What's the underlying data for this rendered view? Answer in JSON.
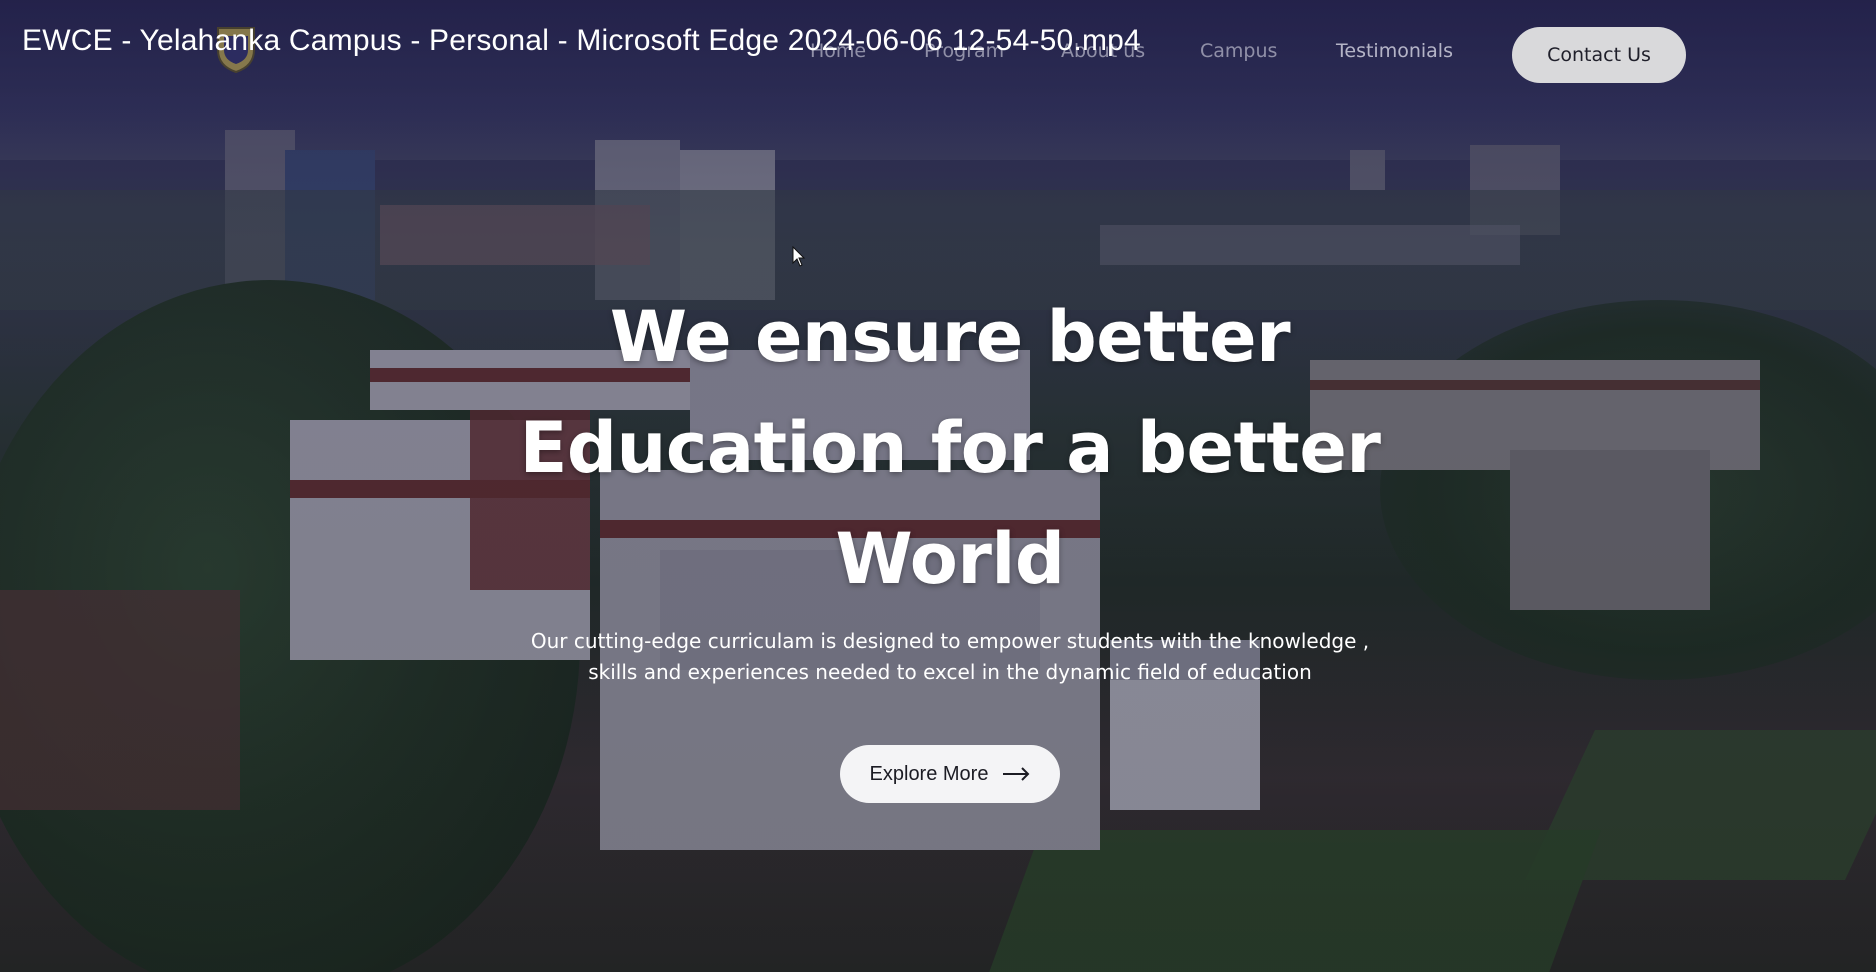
{
  "video": {
    "title": "EWCE - Yelahanka Campus - Personal - Microsoft Edge 2024-06-06 12-54-50.mp4"
  },
  "nav": {
    "links": [
      {
        "label": "Home"
      },
      {
        "label": "Program"
      },
      {
        "label": "About us"
      },
      {
        "label": "Campus"
      },
      {
        "label": "Testimonials"
      }
    ],
    "contact_label": "Contact Us"
  },
  "hero": {
    "heading_lines": [
      "We ensure better",
      "Education for a better",
      "World"
    ],
    "subtitle": "Our cutting-edge curriculam is designed to empower students with the knowledge , skills and experiences needed to excel in the dynamic field of education",
    "cta_label": "Explore More"
  },
  "icons": {
    "logo": "college-crest-icon",
    "cta_arrow": "arrow-right-icon",
    "cursor": "mouse-cursor-icon"
  },
  "colors": {
    "overlay": "#2a2950",
    "button_bg": "#f4f4f6",
    "contact_bg": "#d9d9db",
    "text": "#ffffff"
  }
}
